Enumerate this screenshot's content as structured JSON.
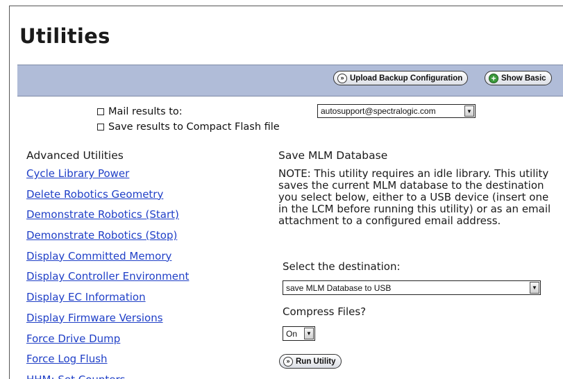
{
  "page": {
    "title": "Utilities"
  },
  "toolbar": {
    "upload_label": "Upload Backup Configuration",
    "show_basic_label": "Show Basic"
  },
  "options": {
    "mail_label": "Mail results to:",
    "mail_selected": "autosupport@spectralogic.com",
    "flash_label": "Save results to Compact Flash file"
  },
  "advanced": {
    "title": "Advanced Utilities",
    "links": [
      "Cycle Library Power",
      "Delete Robotics Geometry",
      "Demonstrate Robotics (Start)",
      "Demonstrate Robotics (Stop)",
      "Display Committed Memory",
      "Display Controller Environment",
      "Display EC Information",
      "Display Firmware Versions",
      "Force Drive Dump",
      "Force Log Flush",
      "HHM: Set Counters"
    ]
  },
  "detail": {
    "title": "Save MLM Database",
    "note": "NOTE: This utility requires an idle library. This utility saves the current MLM database to the destination you select below, either to a USB device (insert one in the LCM before running this utility) or as an email attachment to a configured email address.",
    "destination_label": "Select the destination:",
    "destination_selected": "save MLM Database to USB",
    "compress_label": "Compress Files?",
    "compress_selected": "On",
    "run_label": "Run Utility"
  },
  "colors": {
    "toolbar_bg": "#b0bcd8",
    "link": "#1f3fc7",
    "add_icon": "#3c9a3c"
  }
}
